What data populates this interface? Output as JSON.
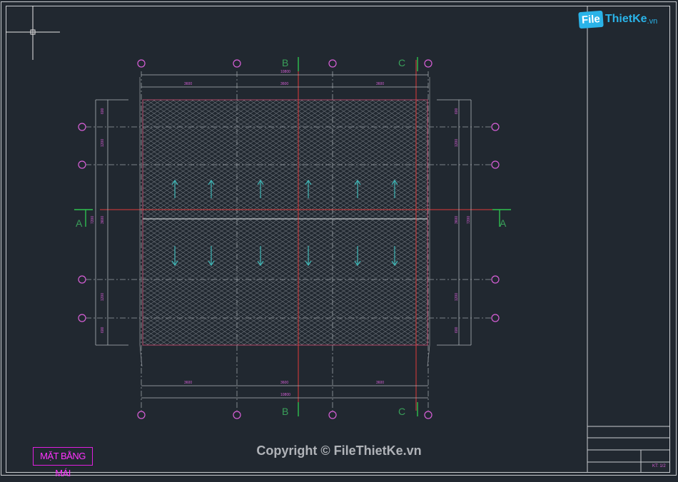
{
  "logo": {
    "box": "File",
    "name": "ThietKe",
    "tld": ".vn"
  },
  "drawing_title": "MẶT BẰNG MÁI",
  "copyright": "Copyright © FileThietKe.vn",
  "scale_label": "KT: 1/2",
  "dims": {
    "top_segments": [
      "3600",
      "3600",
      "3600"
    ],
    "top_total": "10800",
    "bottom_segments": [
      "3600",
      "3600",
      "3600"
    ],
    "bottom_total": "10800",
    "left_segments": [
      "600",
      "1200",
      "3600",
      "1200",
      "600"
    ],
    "left_total": "7200",
    "right_segments": [
      "600",
      "1200",
      "3600",
      "1200",
      "600"
    ],
    "right_total": "7200"
  },
  "section_marks": {
    "b": "B",
    "c": "C",
    "a": "A"
  },
  "colors": {
    "bg": "#212830",
    "frame": "#c9ccd0",
    "axis": "#d85fd8",
    "red": "#e03a3a",
    "hatch": "#6c727a",
    "arrow": "#3fb6b6",
    "green": "#2fc14f",
    "dim": "#aeb3b8"
  }
}
